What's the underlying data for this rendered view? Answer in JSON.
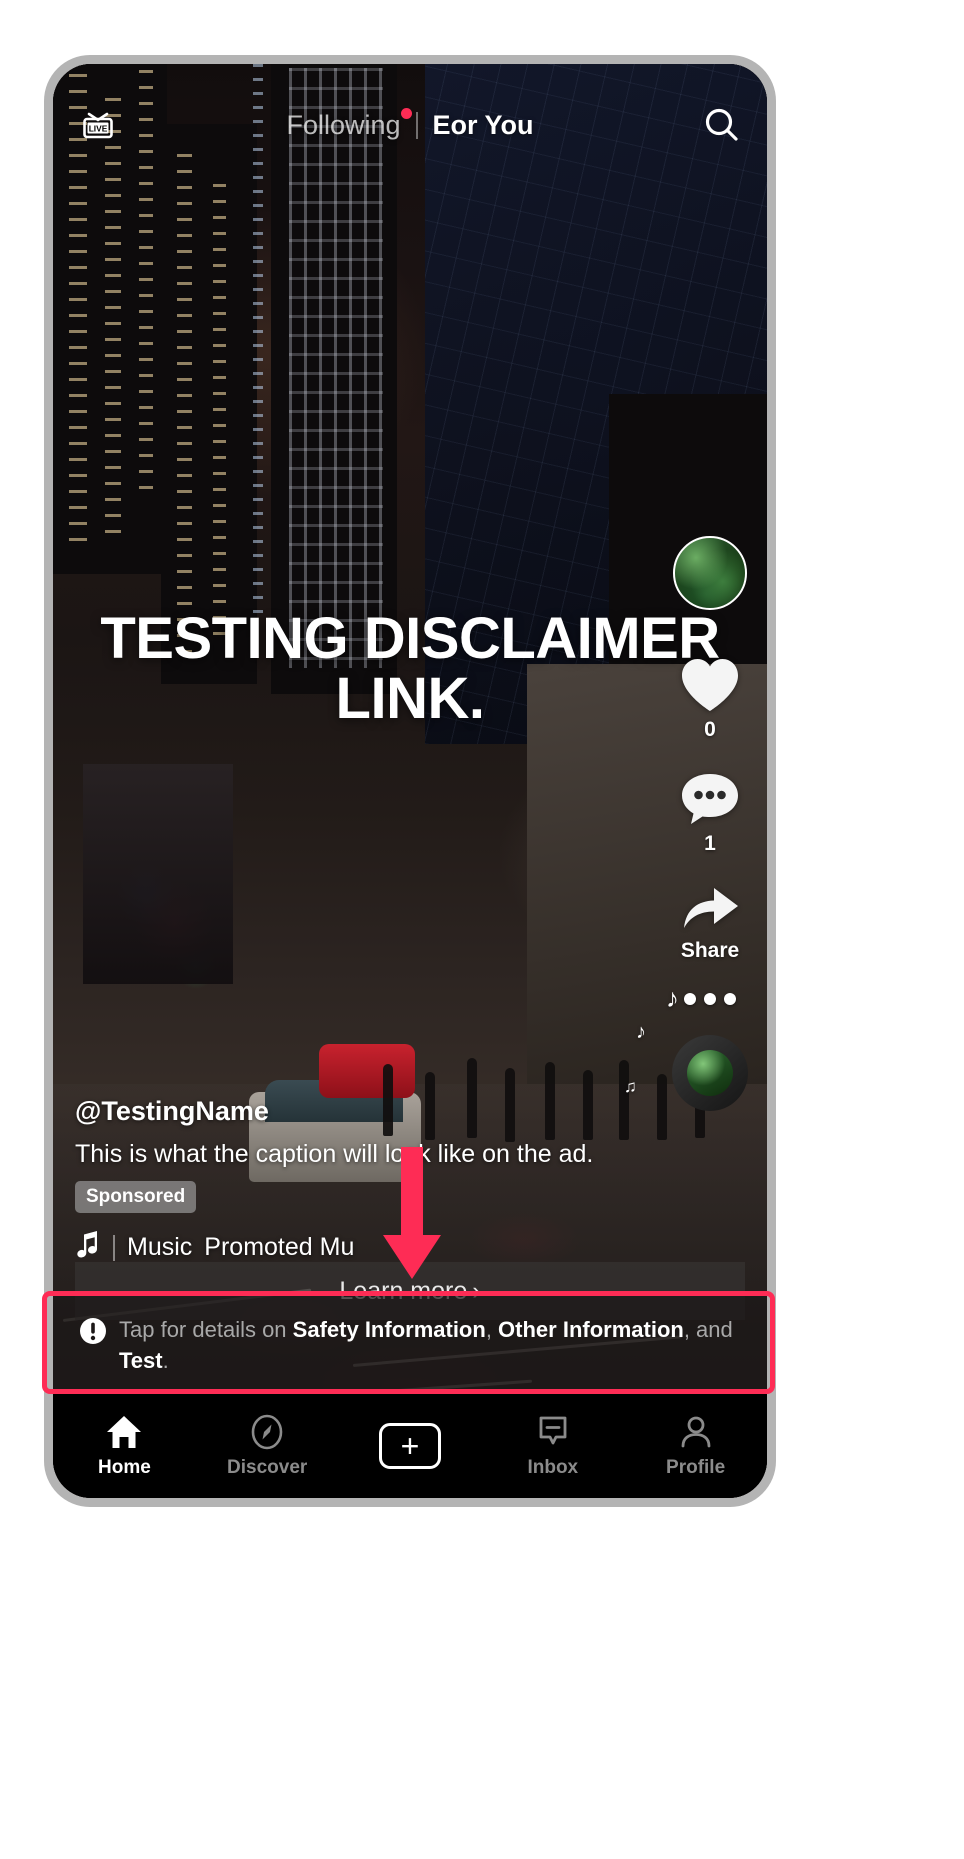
{
  "top_nav": {
    "live_label": "LIVE",
    "tabs": [
      {
        "label": "Following",
        "active": false,
        "has_dot": true
      },
      {
        "label": "Eor You",
        "active": true,
        "has_dot": false
      }
    ],
    "search_icon": "search-icon"
  },
  "video": {
    "headline": "TESTING DISCLAIMER LINK."
  },
  "action_rail": {
    "avatar_icon": "avatar",
    "like": {
      "icon": "heart-icon",
      "count": "0"
    },
    "comment": {
      "icon": "comment-icon",
      "count": "1"
    },
    "share": {
      "icon": "share-arrow-icon",
      "label": "Share"
    },
    "more_icon": "three-dots-icon",
    "music_disc_icon": "music-disc"
  },
  "ad_info": {
    "handle": "@TestingName",
    "caption": "This is what the caption will look like on the ad.",
    "sponsored_badge": "Sponsored",
    "music_icon": "music-note-icon",
    "music_label": "Music",
    "music_track": "Promoted Mu"
  },
  "cta": {
    "label": "Learn more",
    "chevron": "›"
  },
  "disclaimer": {
    "icon": "exclamation-circle-icon",
    "prefix": "Tap for details on ",
    "link1": "Safety Information",
    "sep1": ", ",
    "link2": "Other Information",
    "sep2": ", and ",
    "link3": "Test",
    "suffix": "."
  },
  "tabbar": {
    "items": [
      {
        "label": "Home",
        "icon": "home-icon",
        "active": true
      },
      {
        "label": "Discover",
        "icon": "compass-icon",
        "active": false
      },
      {
        "label": "",
        "icon": "plus-icon",
        "active": false
      },
      {
        "label": "Inbox",
        "icon": "inbox-icon",
        "active": false
      },
      {
        "label": "Profile",
        "icon": "person-icon",
        "active": false
      }
    ],
    "plus_symbol": "+"
  },
  "annotation": {
    "highlight_color": "#fe2c55",
    "arrow_color": "#fe2c55",
    "arrow_icon": "down-arrow-annotation"
  }
}
